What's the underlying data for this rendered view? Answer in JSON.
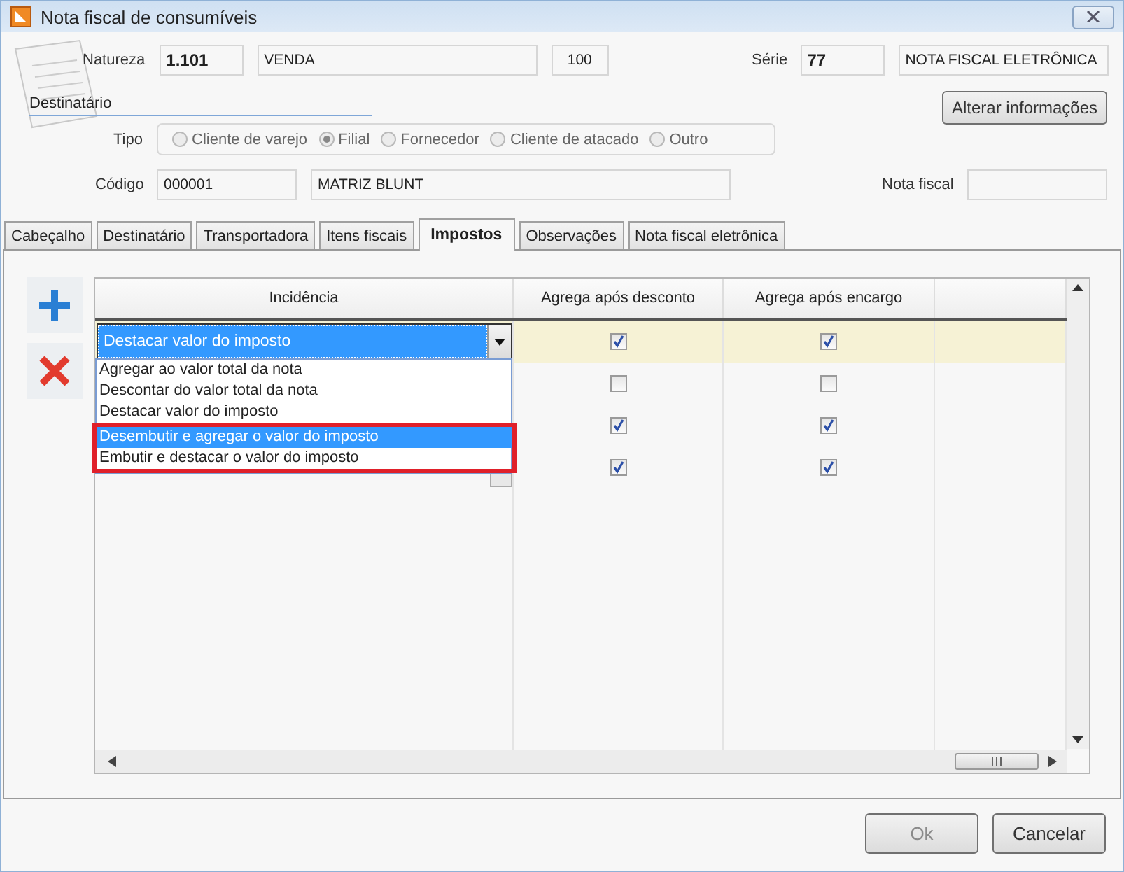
{
  "window": {
    "title": "Nota fiscal de consumíveis"
  },
  "header": {
    "natureza_label": "Natureza",
    "natureza_code": "1.101",
    "natureza_name": "VENDA",
    "natureza_number": "100",
    "serie_label": "Série",
    "serie_code": "77",
    "serie_name": "NOTA FISCAL ELETRÔNICA",
    "section_title": "Destinatário",
    "alter_button": "Alterar informações",
    "tipo_label": "Tipo",
    "tipo_options": [
      {
        "label": "Cliente de varejo",
        "selected": false
      },
      {
        "label": "Filial",
        "selected": true
      },
      {
        "label": "Fornecedor",
        "selected": false
      },
      {
        "label": "Cliente de atacado",
        "selected": false
      },
      {
        "label": "Outro",
        "selected": false
      }
    ],
    "codigo_label": "Código",
    "codigo": "000001",
    "codigo_name": "MATRIZ BLUNT",
    "nota_fiscal_label": "Nota fiscal"
  },
  "tabs": [
    {
      "label": "Cabeçalho",
      "selected": false
    },
    {
      "label": "Destinatário",
      "selected": false
    },
    {
      "label": "Transportadora",
      "selected": false
    },
    {
      "label": "Itens fiscais",
      "selected": false
    },
    {
      "label": "Impostos",
      "selected": true
    },
    {
      "label": "Observações",
      "selected": false
    },
    {
      "label": "Nota fiscal eletrônica",
      "selected": false
    }
  ],
  "grid": {
    "columns": [
      "Incidência",
      "Agrega após desconto",
      "Agrega após encargo"
    ],
    "rows": [
      {
        "incidence": "Destacar valor do imposto",
        "after_discount": true,
        "after_charge": true,
        "selected": true
      },
      {
        "after_discount": false,
        "after_charge": false,
        "selected": false
      },
      {
        "after_discount": true,
        "after_charge": true,
        "selected": false
      },
      {
        "after_discount": true,
        "after_charge": true,
        "selected": false
      }
    ],
    "dropdown_options": [
      {
        "label": "Agregar ao valor total da nota",
        "selected": false,
        "framed": false
      },
      {
        "label": "Descontar do valor total da nota",
        "selected": false,
        "framed": false
      },
      {
        "label": "Destacar valor do imposto",
        "selected": false,
        "framed": false
      },
      {
        "label": "Desembutir e agregar o valor do imposto",
        "selected": true,
        "framed": true
      },
      {
        "label": "Embutir e destacar o valor do imposto",
        "selected": false,
        "framed": true
      }
    ]
  },
  "buttons": [
    {
      "label": "Ok",
      "disabled": true
    },
    {
      "label": "Cancelar",
      "disabled": false
    }
  ]
}
